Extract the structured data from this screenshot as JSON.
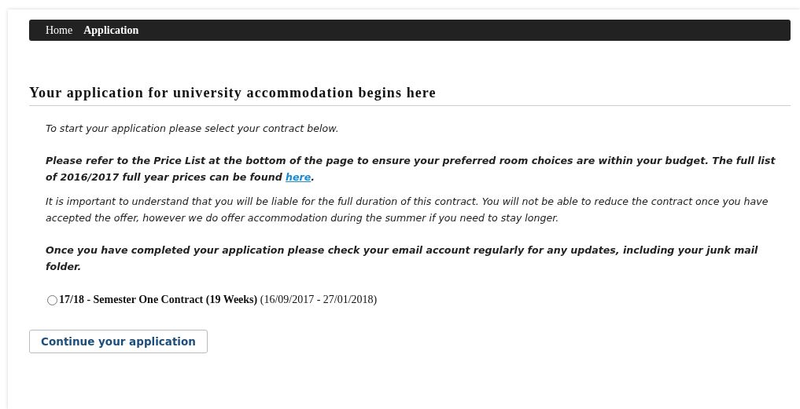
{
  "nav": [
    {
      "label": "Home",
      "selected": false
    },
    {
      "label": "Application",
      "selected": true
    }
  ],
  "heading": "Your application for university accommodation begins here",
  "paragraphs": [
    {
      "kind": "plain",
      "text": "To start your application please select your contract below."
    },
    {
      "kind": "strong",
      "text": "Please refer to the Price List at the bottom of the page to ensure your preferred room choices are within your budget. The full list of 2016/2017 full year prices can be found ",
      "link": "here",
      "after": "."
    },
    {
      "kind": "plain",
      "text": "It is important to understand that you will be liable for the full duration of this contract. You will not be able to reduce the contract once you have accepted the offer, however we do offer accommodation during the summer if you need to stay longer."
    },
    {
      "kind": "strong",
      "text": "Once you have completed your application please check your email account regularly for any updates, including your junk mail folder."
    }
  ],
  "contracts": [
    {
      "name": "17/18 - Semester One Contract (19 Weeks)",
      "dates": "(16/09/2017 - 27/01/2018)",
      "selected": false
    }
  ],
  "button": "Continue your application"
}
